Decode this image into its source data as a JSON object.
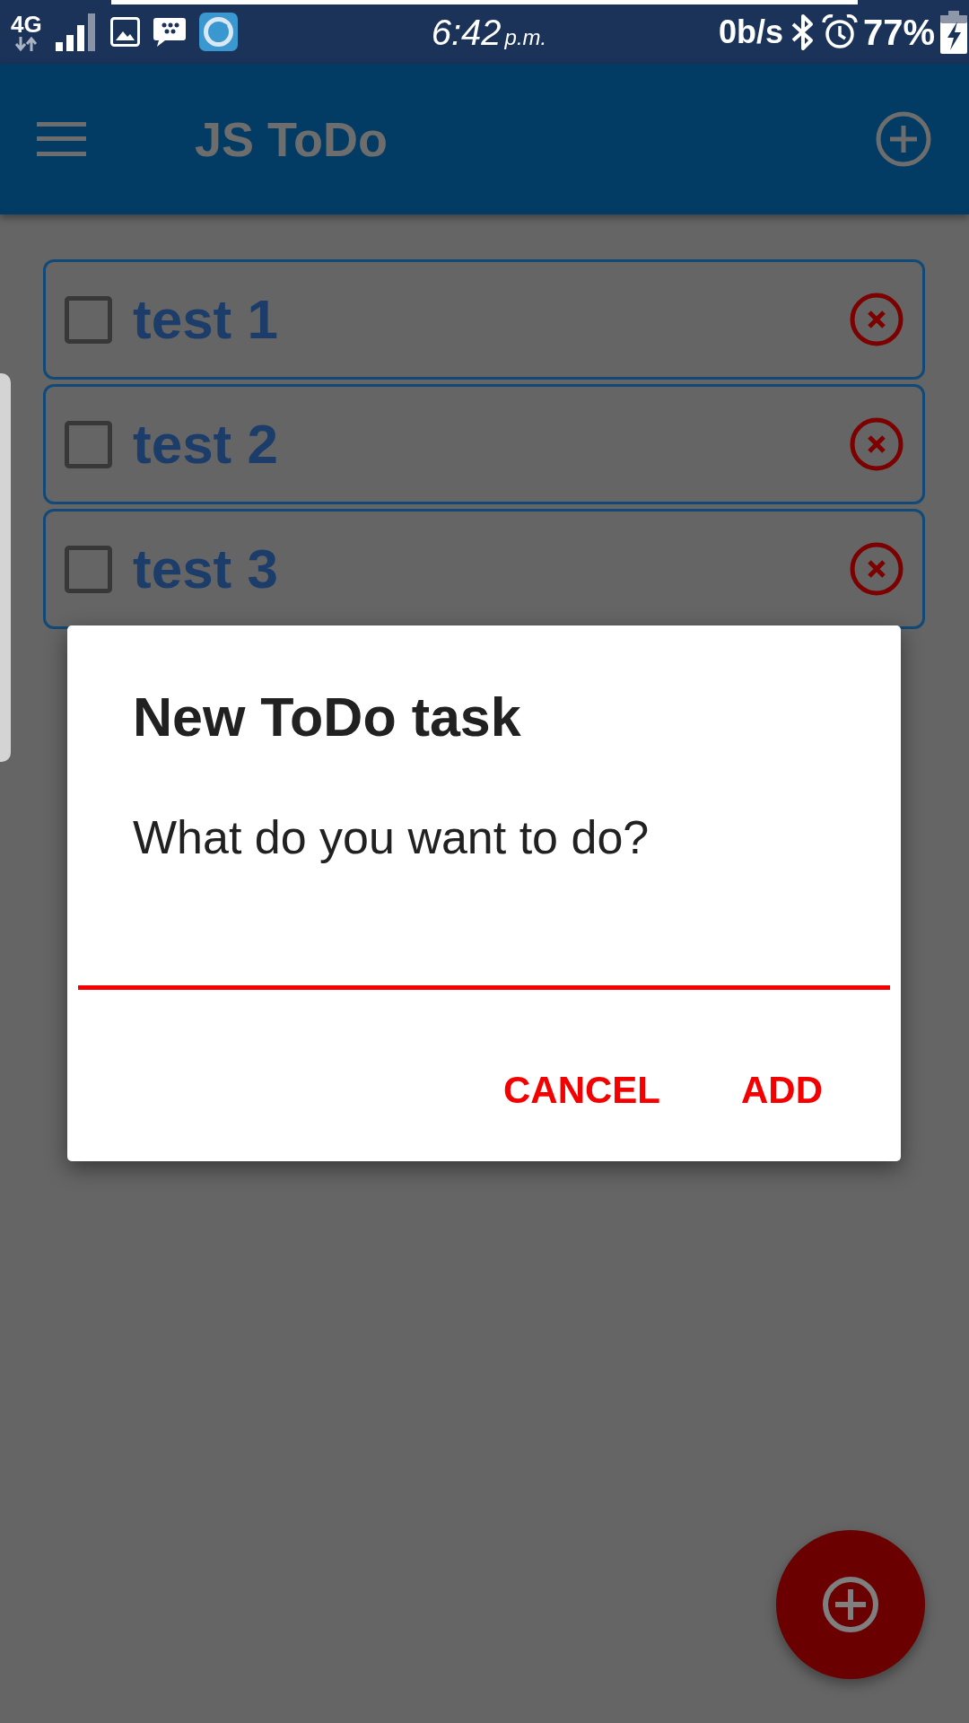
{
  "status_bar": {
    "network": "4G",
    "time": "6:42",
    "time_suffix": "p.m.",
    "data_rate": "0b/s",
    "battery": "77%"
  },
  "app_bar": {
    "title": "JS ToDo"
  },
  "tasks": [
    {
      "text": "test 1",
      "checked": false
    },
    {
      "text": "test 2",
      "checked": false
    },
    {
      "text": "test 3",
      "checked": false
    }
  ],
  "dialog": {
    "title": "New ToDo task",
    "message": "What do you want to do?",
    "input": {
      "focused": true
    },
    "buttons": [
      "CANCEL",
      "ADD"
    ]
  }
}
